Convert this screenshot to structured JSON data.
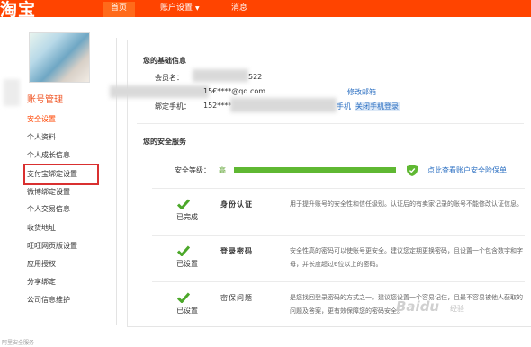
{
  "header": {
    "logo": "淘宝",
    "nav": [
      {
        "label": "首页",
        "active": true
      },
      {
        "label": "账户设置",
        "has_caret": true
      },
      {
        "label": "消息"
      }
    ]
  },
  "sidebar": {
    "title": "账号管理",
    "items": [
      {
        "label": "安全设置",
        "current": true
      },
      {
        "label": "个人资料"
      },
      {
        "label": "个人成长信息"
      },
      {
        "label": "支付宝绑定设置",
        "highlighted": true
      },
      {
        "label": "微博绑定设置"
      },
      {
        "label": "个人交易信息"
      },
      {
        "label": "收货地址"
      },
      {
        "label": "旺旺网页版设置"
      },
      {
        "label": "应用授权"
      },
      {
        "label": "分享绑定"
      },
      {
        "label": "公司信息维护"
      }
    ]
  },
  "basic_info": {
    "title": "您的基础信息",
    "member_label": "会员名：",
    "member_value_tail": "522",
    "email_value": "15€****@qq.com",
    "email_link": "修改邮箱",
    "phone_label": "绑定手机：",
    "phone_value": "152****",
    "phone_link_partial": "手机",
    "phone_close_link": "关闭手机登录"
  },
  "security": {
    "title": "您的安全服务",
    "level_label": "安全等级：",
    "level_value": "高",
    "level_fraction": 1.0,
    "level_link": "点此查看账户安全险保单",
    "colors": {
      "accent": "#ff4400",
      "green": "#5fb832",
      "link": "#2b6fc2"
    },
    "services": [
      {
        "status": "已完成",
        "name": "身份认证",
        "desc": "用于提升账号的安全性和信任级别。认证后的有卖家记录的账号不能修改认证信息。"
      },
      {
        "status": "已设置",
        "name": "登录密码",
        "desc": "安全性高的密码可以使账号更安全。建议您定期更换密码，且设置一个包含数字和字母，并长度超过6位以上的密码。"
      },
      {
        "status": "已设置",
        "name": "密保问题",
        "desc": "是您找回登录密码的方式之一。建议您设置一个容易记住，且最不容易被他人获取的问题及答案，更有效保障您的密码安全。"
      }
    ]
  },
  "watermark": {
    "brand": "Baidu",
    "sub": "经验"
  },
  "footer_note": "阿里安全服务"
}
